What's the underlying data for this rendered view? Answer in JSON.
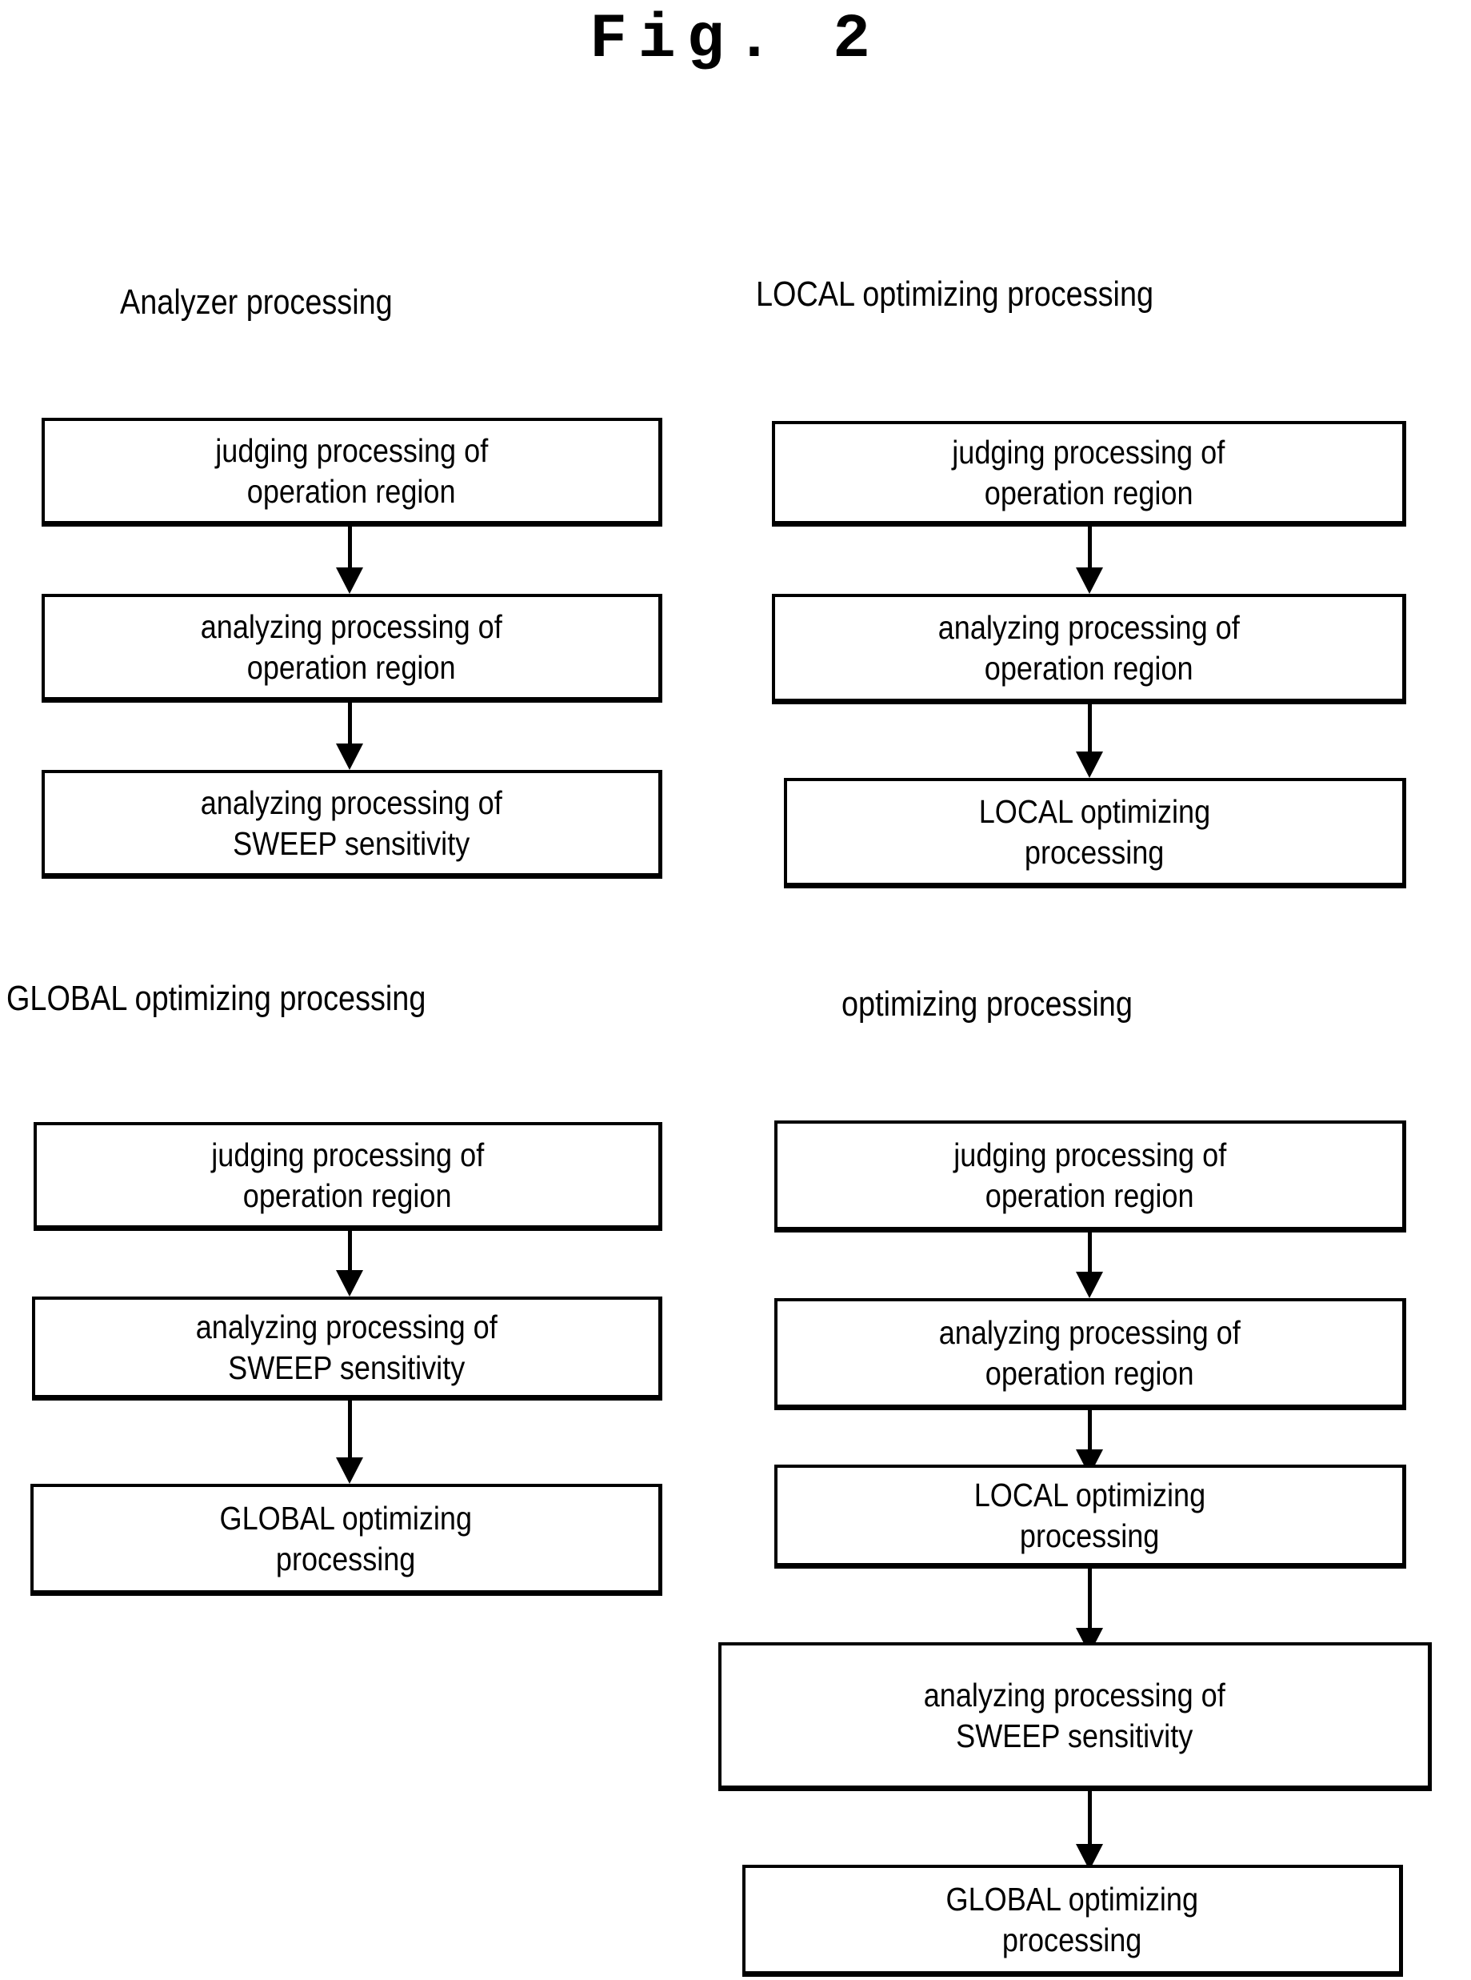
{
  "figure": {
    "title": "Fig. 2"
  },
  "panels": [
    {
      "id": "analyzer-processing",
      "header": "Analyzer processing",
      "steps": [
        {
          "line1": "judging processing of",
          "line2": "operation region"
        },
        {
          "line1": "analyzing processing of",
          "line2": "operation region"
        },
        {
          "line1": "analyzing processing of",
          "line2": "SWEEP sensitivity"
        }
      ]
    },
    {
      "id": "local-optimizing-processing",
      "header": "LOCAL optimizing processing",
      "steps": [
        {
          "line1": "judging processing of",
          "line2": "operation region"
        },
        {
          "line1": "analyzing processing of",
          "line2": "operation region"
        },
        {
          "line1": "LOCAL optimizing",
          "line2": "processing"
        }
      ]
    },
    {
      "id": "global-optimizing-processing",
      "header": "GLOBAL optimizing processing",
      "steps": [
        {
          "line1": "judging processing of",
          "line2": "operation region"
        },
        {
          "line1": "analyzing processing of",
          "line2": "SWEEP sensitivity"
        },
        {
          "line1": "GLOBAL optimizing",
          "line2": "processing"
        }
      ]
    },
    {
      "id": "optimizing-processing",
      "header": "optimizing processing",
      "steps": [
        {
          "line1": "judging processing of",
          "line2": "operation region"
        },
        {
          "line1": "analyzing processing of",
          "line2": "operation region"
        },
        {
          "line1": "LOCAL optimizing",
          "line2": "processing"
        },
        {
          "line1": "analyzing processing of",
          "line2": "SWEEP sensitivity"
        },
        {
          "line1": "GLOBAL optimizing",
          "line2": "processing"
        }
      ]
    }
  ],
  "colors": {
    "ink": "#000000",
    "paper": "#ffffff"
  }
}
